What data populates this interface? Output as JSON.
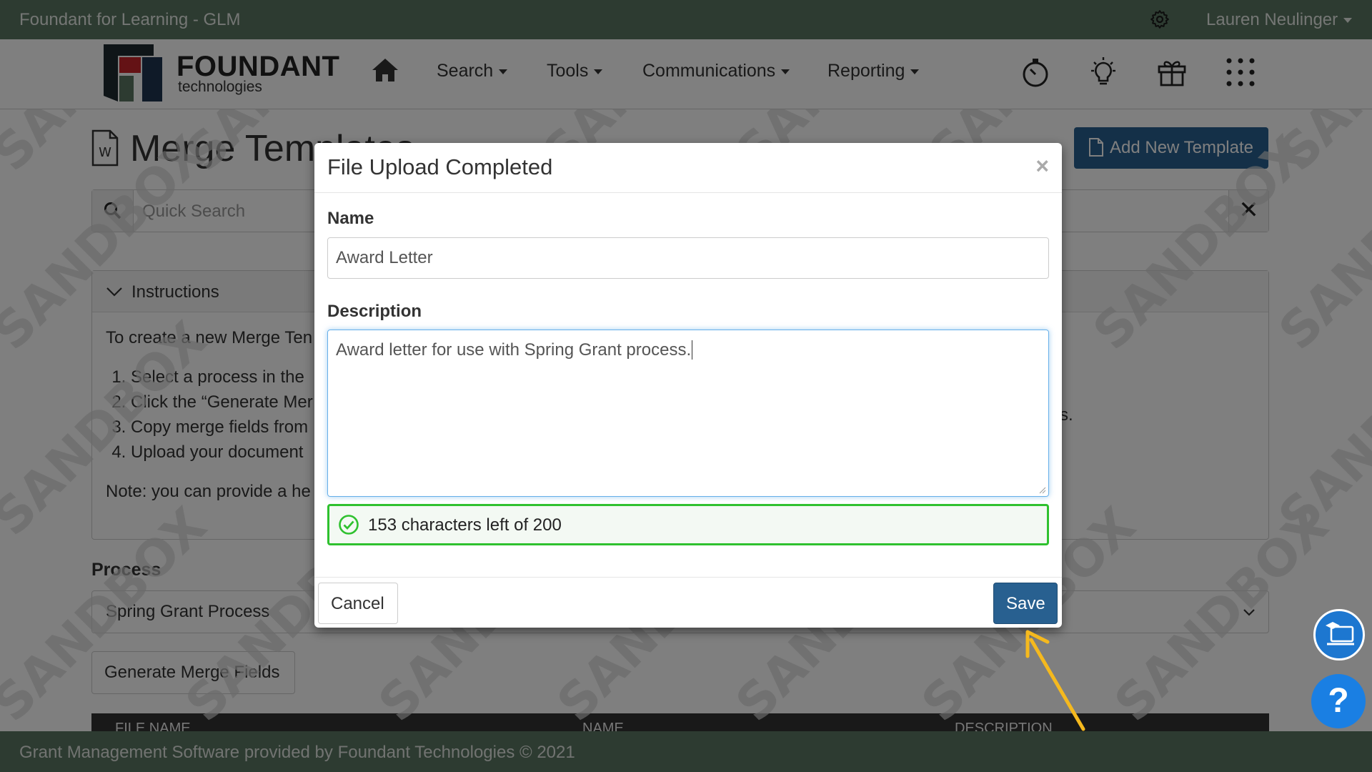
{
  "topbar": {
    "app_title": "Foundant for Learning - GLM",
    "user_name": "Lauren Neulinger"
  },
  "navbar": {
    "logo_name": "FOUNDANT",
    "logo_sub": "technologies",
    "items": [
      "Search",
      "Tools",
      "Communications",
      "Reporting"
    ]
  },
  "page": {
    "title": "Merge Templates",
    "add_button": "Add New Template",
    "search_placeholder": "Quick Search",
    "instructions_title": "Instructions",
    "instructions_intro": "To create a new Merge Ten",
    "steps": [
      "Select a process in the",
      "Click the “Generate Mer",
      "Copy merge fields from",
      "Upload your document"
    ],
    "step2_tail": "s.",
    "note": "Note: you can provide a he",
    "process_label": "Process",
    "process_value": "Spring Grant Process",
    "generate_button": "Generate Merge Fields",
    "table_columns": [
      "FILE NAME",
      "NAME",
      "DESCRIPTION"
    ],
    "watermark": "SANDBOX"
  },
  "modal": {
    "title": "File Upload Completed",
    "name_label": "Name",
    "name_value": "Award Letter",
    "description_label": "Description",
    "description_value": "Award letter for use with Spring Grant process.",
    "char_count": "153 characters left of 200",
    "cancel": "Cancel",
    "save": "Save"
  },
  "footer": {
    "text": "Grant Management Software provided by Foundant Technologies © 2021"
  },
  "help": {
    "label": "?"
  },
  "colors": {
    "header_green": "#5b7662",
    "primary_blue": "#286090",
    "success_green": "#2fc12f",
    "arrow_yellow": "#f5b91e"
  }
}
